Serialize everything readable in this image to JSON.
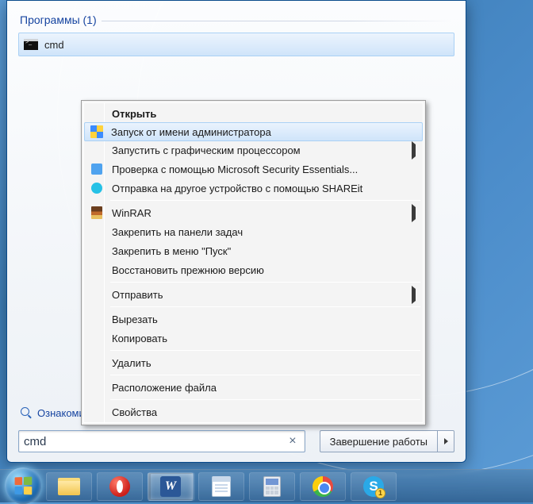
{
  "start_panel": {
    "header": "Программы (1)",
    "result": {
      "label": "cmd"
    },
    "more_results": "Ознакомиться с другими результатами",
    "search_value": "cmd",
    "shutdown_label": "Завершение работы"
  },
  "context_menu": {
    "items": [
      {
        "label": "Открыть",
        "bold": true
      },
      {
        "label": "Запуск от имени администратора",
        "icon": "shield",
        "highlighted": true
      },
      {
        "label": "Запустить с графическим процессором",
        "submenu": true
      },
      {
        "label": "Проверка с помощью Microsoft Security Essentials...",
        "icon": "mse"
      },
      {
        "label": "Отправка на другое устройство с помощью SHAREit",
        "icon": "shareit"
      },
      {
        "sep": true
      },
      {
        "label": "WinRAR",
        "icon": "rar",
        "submenu": true
      },
      {
        "label": "Закрепить на панели задач"
      },
      {
        "label": "Закрепить в меню \"Пуск\""
      },
      {
        "label": "Восстановить прежнюю версию"
      },
      {
        "sep": true
      },
      {
        "label": "Отправить",
        "submenu": true
      },
      {
        "sep": true
      },
      {
        "label": "Вырезать"
      },
      {
        "label": "Копировать"
      },
      {
        "sep": true
      },
      {
        "label": "Удалить"
      },
      {
        "sep": true
      },
      {
        "label": "Расположение файла"
      },
      {
        "sep": true
      },
      {
        "label": "Свойства"
      }
    ]
  },
  "taskbar": {
    "items": [
      {
        "name": "start",
        "type": "orb"
      },
      {
        "name": "explorer"
      },
      {
        "name": "opera"
      },
      {
        "name": "word",
        "active": true,
        "stacked": true
      },
      {
        "name": "notepad"
      },
      {
        "name": "calculator"
      },
      {
        "name": "chrome"
      },
      {
        "name": "skype",
        "badge": "1"
      }
    ]
  }
}
